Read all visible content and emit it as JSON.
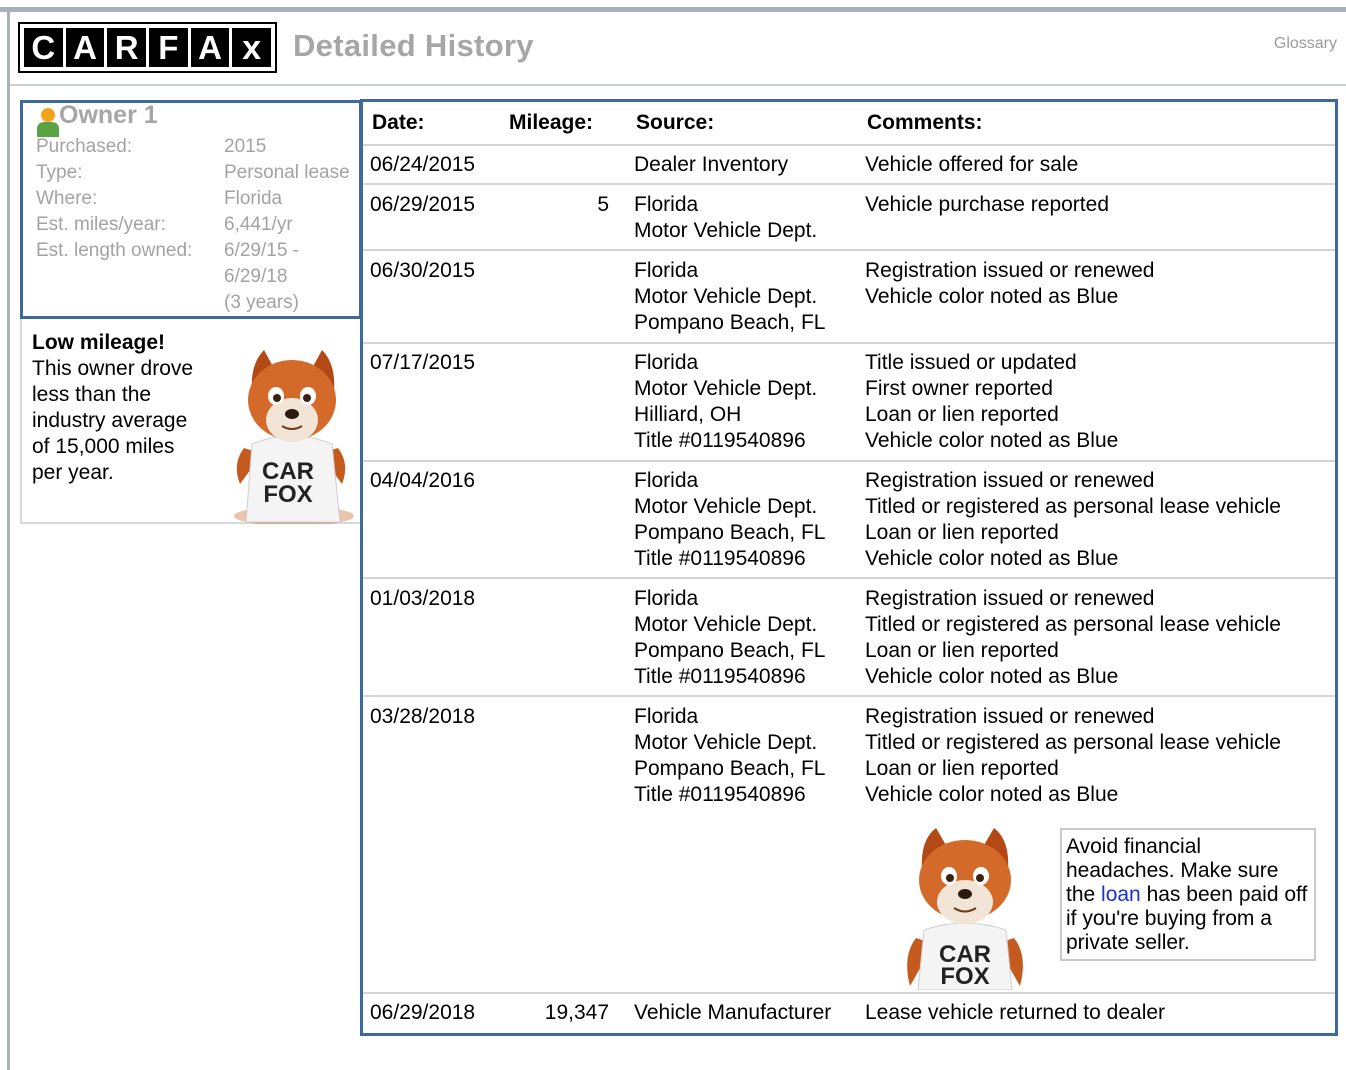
{
  "header": {
    "logo_letters": [
      "C",
      "A",
      "R",
      "F",
      "A",
      "x"
    ],
    "title": "Detailed History",
    "glossary_label": "Glossary"
  },
  "owner": {
    "title": "Owner 1",
    "fields": [
      {
        "label": "Purchased:",
        "value": "2015"
      },
      {
        "label": "Type:",
        "value": "Personal lease"
      },
      {
        "label": "Where:",
        "value": "Florida"
      },
      {
        "label": "Est. miles/year:",
        "value": "6,441/yr"
      },
      {
        "label": "Est. length owned:",
        "value": "6/29/15 -"
      }
    ],
    "length_line2": "6/29/18",
    "length_line3": "(3 years)"
  },
  "mileage_note": {
    "headline": "Low mileage!",
    "lines": [
      "This owner drove",
      "less than the",
      "industry average",
      "of 15,000 miles",
      "per year."
    ]
  },
  "fox": {
    "shirt_line1": "CAR",
    "shirt_line2": "FOX"
  },
  "table": {
    "headers": {
      "date": "Date:",
      "mileage": "Mileage:",
      "source": "Source:",
      "comments": "Comments:"
    },
    "rows": [
      {
        "date": "06/24/2015",
        "mileage": "",
        "source": [
          "Dealer Inventory"
        ],
        "comments": [
          "Vehicle offered for sale"
        ]
      },
      {
        "date": "06/29/2015",
        "mileage": "5",
        "source": [
          "Florida",
          "Motor Vehicle Dept."
        ],
        "comments": [
          "Vehicle purchase reported"
        ]
      },
      {
        "date": "06/30/2015",
        "mileage": "",
        "source": [
          "Florida",
          "Motor Vehicle Dept.",
          "Pompano Beach, FL"
        ],
        "comments": [
          "Registration issued or renewed",
          "Vehicle color noted as Blue"
        ]
      },
      {
        "date": "07/17/2015",
        "mileage": "",
        "source": [
          "Florida",
          "Motor Vehicle Dept.",
          "Hilliard, OH",
          "Title #0119540896"
        ],
        "comments": [
          "Title issued or updated",
          "First owner reported",
          "Loan or lien reported",
          "Vehicle color noted as Blue"
        ]
      },
      {
        "date": "04/04/2016",
        "mileage": "",
        "source": [
          "Florida",
          "Motor Vehicle Dept.",
          "Pompano Beach, FL",
          "Title #0119540896"
        ],
        "comments": [
          "Registration issued or renewed",
          "Titled or registered as personal lease vehicle",
          "Loan or lien reported",
          "Vehicle color noted as Blue"
        ]
      },
      {
        "date": "01/03/2018",
        "mileage": "",
        "source": [
          "Florida",
          "Motor Vehicle Dept.",
          "Pompano Beach, FL",
          "Title #0119540896"
        ],
        "comments": [
          "Registration issued or renewed",
          "Titled or registered as personal lease vehicle",
          "Loan or lien reported",
          "Vehicle color noted as Blue"
        ]
      },
      {
        "date": "03/28/2018",
        "mileage": "",
        "source": [
          "Florida",
          "Motor Vehicle Dept.",
          "Pompano Beach, FL",
          "Title #0119540896"
        ],
        "comments": [
          "Registration issued or renewed",
          "Titled or registered as personal lease vehicle",
          "Loan or lien reported",
          "Vehicle color noted as Blue"
        ]
      },
      {
        "date": "06/29/2018",
        "mileage": "19,347",
        "source": [
          "Vehicle Manufacturer"
        ],
        "comments": [
          "Lease vehicle returned to dealer"
        ]
      }
    ]
  },
  "tip": {
    "before": "Avoid financial headaches. Make sure the ",
    "link": "loan",
    "after": " has been paid off if you're buying from a private seller."
  }
}
